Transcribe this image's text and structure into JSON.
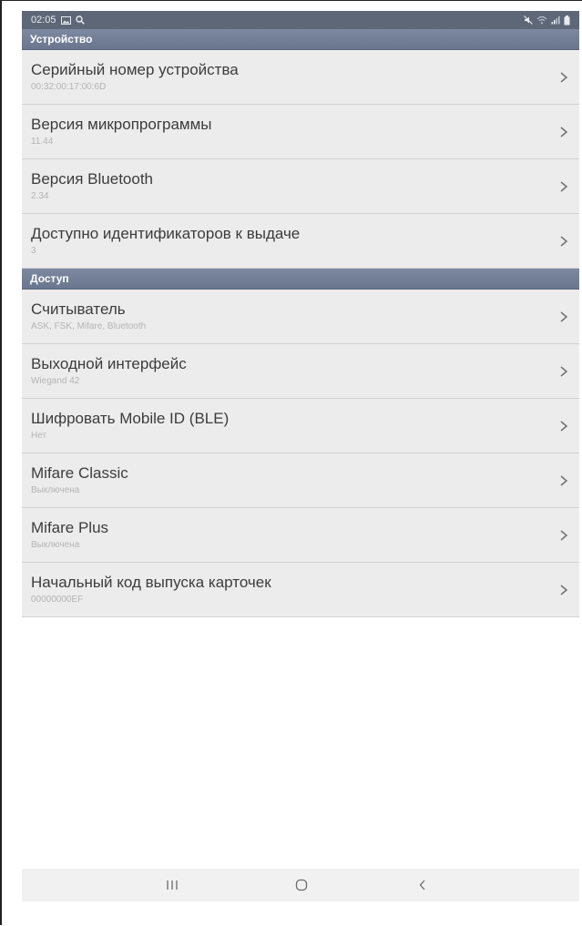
{
  "status_bar": {
    "time": "02:05",
    "icons_left": [
      "image-icon",
      "search-icon"
    ],
    "icons_right": [
      "mute-icon",
      "wifi-icon",
      "signal-icon",
      "battery-icon"
    ]
  },
  "sections": [
    {
      "header": "Устройство",
      "items": [
        {
          "title": "Серийный номер устройства",
          "subtitle": "00:32:00:17:00:6D"
        },
        {
          "title": "Версия микропрограммы",
          "subtitle": "11.44"
        },
        {
          "title": "Версия Bluetooth",
          "subtitle": "2.34"
        },
        {
          "title": "Доступно идентификаторов к выдаче",
          "subtitle": "3"
        }
      ]
    },
    {
      "header": "Доступ",
      "items": [
        {
          "title": "Считыватель",
          "subtitle": "ASK, FSK, Mifare, Bluetooth"
        },
        {
          "title": "Выходной интерфейс",
          "subtitle": "Wiegand 42"
        },
        {
          "title": "Шифровать Mobile ID (BLE)",
          "subtitle": "Нет"
        },
        {
          "title": "Mifare Classic",
          "subtitle": "Выключена"
        },
        {
          "title": "Mifare Plus",
          "subtitle": "Выключена"
        },
        {
          "title": "Начальный код выпуска карточек",
          "subtitle": "00000000EF"
        }
      ]
    }
  ],
  "nav_bar": {
    "buttons": [
      "recent-apps",
      "home",
      "back"
    ]
  },
  "colors": {
    "status_bar": "#5e6777",
    "section_header": "#737f96",
    "row_background": "#ececec",
    "title_text": "#3c3c3c",
    "subtitle_text": "#b4b4b4"
  }
}
